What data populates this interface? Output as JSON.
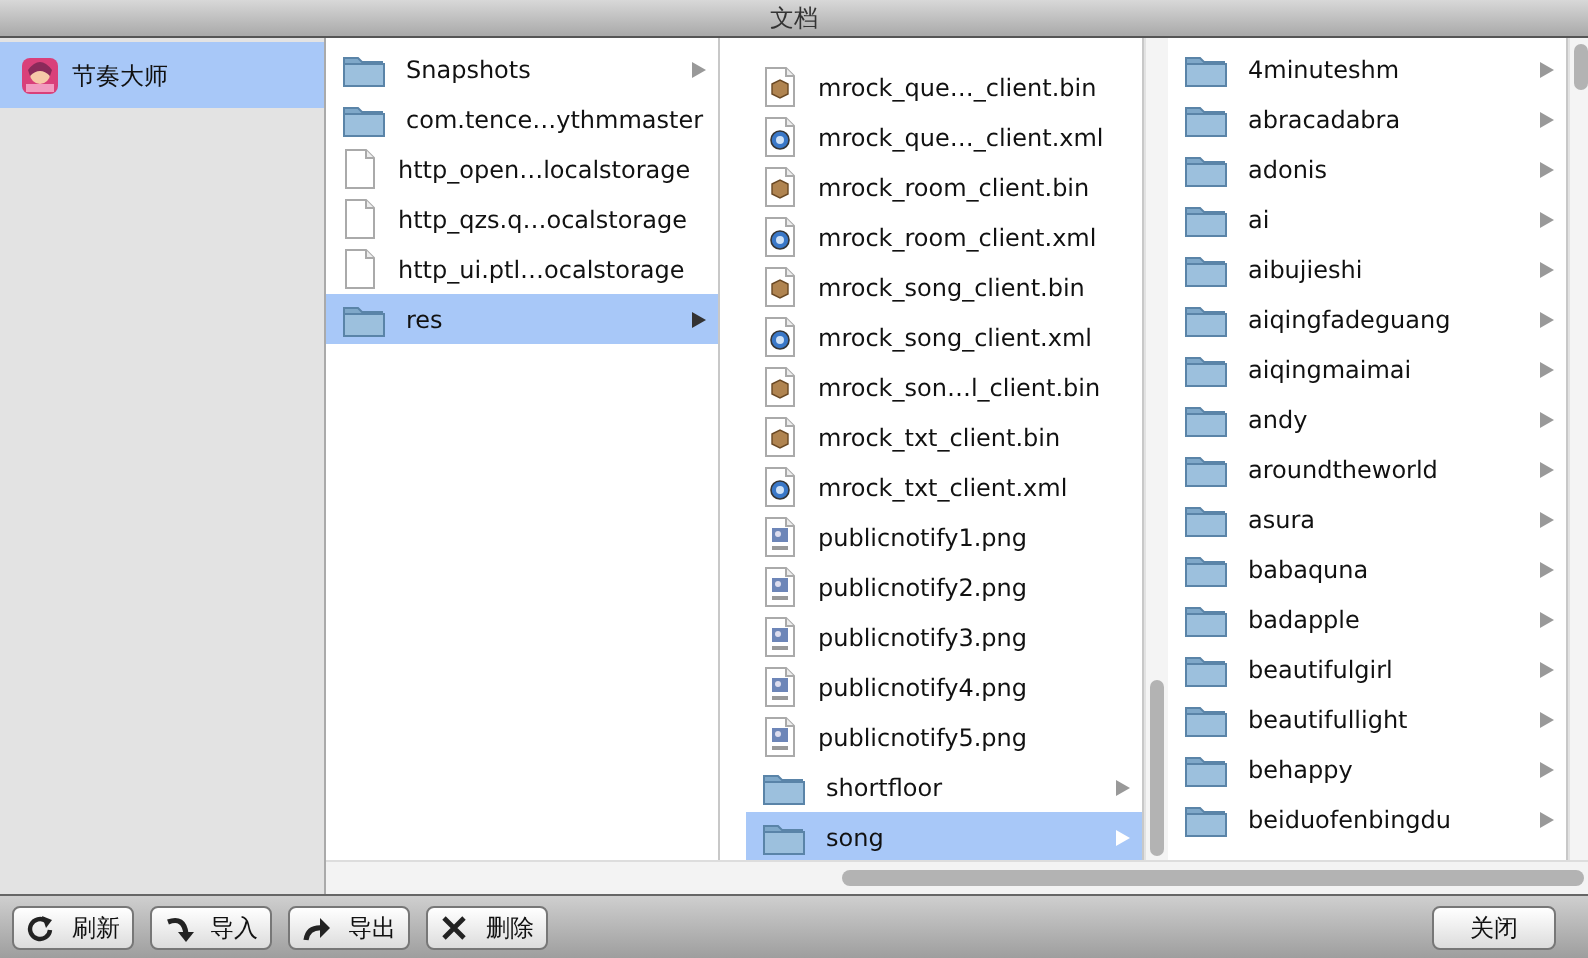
{
  "window": {
    "title": "文档"
  },
  "sidebar": {
    "items": [
      {
        "label": "节奏大师",
        "selected": true
      }
    ]
  },
  "columns": [
    {
      "items": [
        {
          "name": "Snapshots",
          "kind": "folder",
          "selected": false
        },
        {
          "name": "com.tence…ythmmaster",
          "kind": "folder",
          "selected": false
        },
        {
          "name": "http_open…localstorage",
          "kind": "doc",
          "selected": false
        },
        {
          "name": "http_qzs.q…ocalstorage",
          "kind": "doc",
          "selected": false
        },
        {
          "name": "http_ui.ptl…ocalstorage",
          "kind": "doc",
          "selected": false
        },
        {
          "name": "res",
          "kind": "folder",
          "selected": true
        }
      ]
    },
    {
      "items": [
        {
          "name": "mrock_que…_client.bin",
          "kind": "bin",
          "selected": false
        },
        {
          "name": "mrock_que…_client.xml",
          "kind": "xml",
          "selected": false
        },
        {
          "name": "mrock_room_client.bin",
          "kind": "bin",
          "selected": false
        },
        {
          "name": "mrock_room_client.xml",
          "kind": "xml",
          "selected": false
        },
        {
          "name": "mrock_song_client.bin",
          "kind": "bin",
          "selected": false
        },
        {
          "name": "mrock_song_client.xml",
          "kind": "xml",
          "selected": false
        },
        {
          "name": "mrock_son…l_client.bin",
          "kind": "bin",
          "selected": false
        },
        {
          "name": "mrock_txt_client.bin",
          "kind": "bin",
          "selected": false
        },
        {
          "name": "mrock_txt_client.xml",
          "kind": "xml",
          "selected": false
        },
        {
          "name": "publicnotify1.png",
          "kind": "png",
          "selected": false
        },
        {
          "name": "publicnotify2.png",
          "kind": "png",
          "selected": false
        },
        {
          "name": "publicnotify3.png",
          "kind": "png",
          "selected": false
        },
        {
          "name": "publicnotify4.png",
          "kind": "png",
          "selected": false
        },
        {
          "name": "publicnotify5.png",
          "kind": "png",
          "selected": false
        },
        {
          "name": "shortfloor",
          "kind": "folder",
          "selected": false
        },
        {
          "name": "song",
          "kind": "folder",
          "selected": true
        }
      ]
    },
    {
      "items": [
        {
          "name": "4minuteshm",
          "kind": "folder",
          "selected": false
        },
        {
          "name": "abracadabra",
          "kind": "folder",
          "selected": false
        },
        {
          "name": "adonis",
          "kind": "folder",
          "selected": false
        },
        {
          "name": "ai",
          "kind": "folder",
          "selected": false
        },
        {
          "name": "aibujieshi",
          "kind": "folder",
          "selected": false
        },
        {
          "name": "aiqingfadeguang",
          "kind": "folder",
          "selected": false
        },
        {
          "name": "aiqingmaimai",
          "kind": "folder",
          "selected": false
        },
        {
          "name": "andy",
          "kind": "folder",
          "selected": false
        },
        {
          "name": "aroundtheworld",
          "kind": "folder",
          "selected": false
        },
        {
          "name": "asura",
          "kind": "folder",
          "selected": false
        },
        {
          "name": "babaquna",
          "kind": "folder",
          "selected": false
        },
        {
          "name": "badapple",
          "kind": "folder",
          "selected": false
        },
        {
          "name": "beautifulgirl",
          "kind": "folder",
          "selected": false
        },
        {
          "name": "beautifullight",
          "kind": "folder",
          "selected": false
        },
        {
          "name": "behappy",
          "kind": "folder",
          "selected": false
        },
        {
          "name": "beiduofenbingdu",
          "kind": "folder",
          "selected": false
        }
      ]
    }
  ],
  "toolbar": {
    "buttons": [
      {
        "label": "刷新",
        "kind": "refresh"
      },
      {
        "label": "导入",
        "kind": "import"
      },
      {
        "label": "导出",
        "kind": "export"
      },
      {
        "label": "删除",
        "kind": "delete"
      }
    ]
  },
  "close_button": {
    "label": "关闭"
  }
}
